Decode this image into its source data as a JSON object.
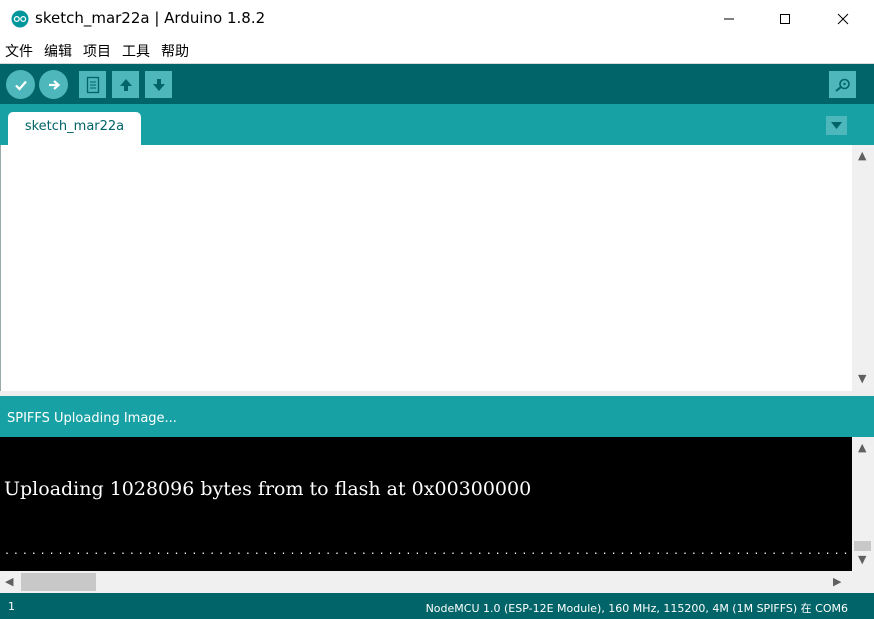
{
  "window": {
    "title": "sketch_mar22a | Arduino 1.8.2",
    "icons": {
      "app": "arduino-logo-icon",
      "minimize": "minimize-icon",
      "maximize": "maximize-icon",
      "close": "close-icon"
    }
  },
  "menu": {
    "items": [
      {
        "label": "文件"
      },
      {
        "label": "编辑"
      },
      {
        "label": "项目"
      },
      {
        "label": "工具"
      },
      {
        "label": "帮助"
      }
    ]
  },
  "toolbar": {
    "buttons": [
      {
        "name": "verify",
        "icon": "checkmark-icon"
      },
      {
        "name": "upload",
        "icon": "right-arrow-icon"
      },
      {
        "name": "new",
        "icon": "new-file-icon"
      },
      {
        "name": "open",
        "icon": "open-up-arrow-icon"
      },
      {
        "name": "save",
        "icon": "save-down-arrow-icon"
      },
      {
        "name": "serial-monitor",
        "icon": "magnifier-icon"
      }
    ]
  },
  "tabs": {
    "items": [
      {
        "label": "sketch_mar22a"
      }
    ],
    "menu_icon": "triangle-down-icon"
  },
  "editor": {
    "content": ""
  },
  "status": {
    "message": "SPIFFS Uploading Image..."
  },
  "console": {
    "line": "Uploading 1028096 bytes from to flash at 0x00300000",
    "progress_dots": "......................................................................................................................."
  },
  "footer": {
    "line_number": "1",
    "board_info": "NodeMCU 1.0 (ESP-12E Module), 160 MHz, 115200, 4M (1M SPIFFS) 在 COM6"
  },
  "colors": {
    "toolbar_bg": "#006468",
    "tab_strip_bg": "#17a1a5",
    "button_bg": "#4db7bb",
    "console_bg": "#000000",
    "console_text": "#ffffff"
  }
}
